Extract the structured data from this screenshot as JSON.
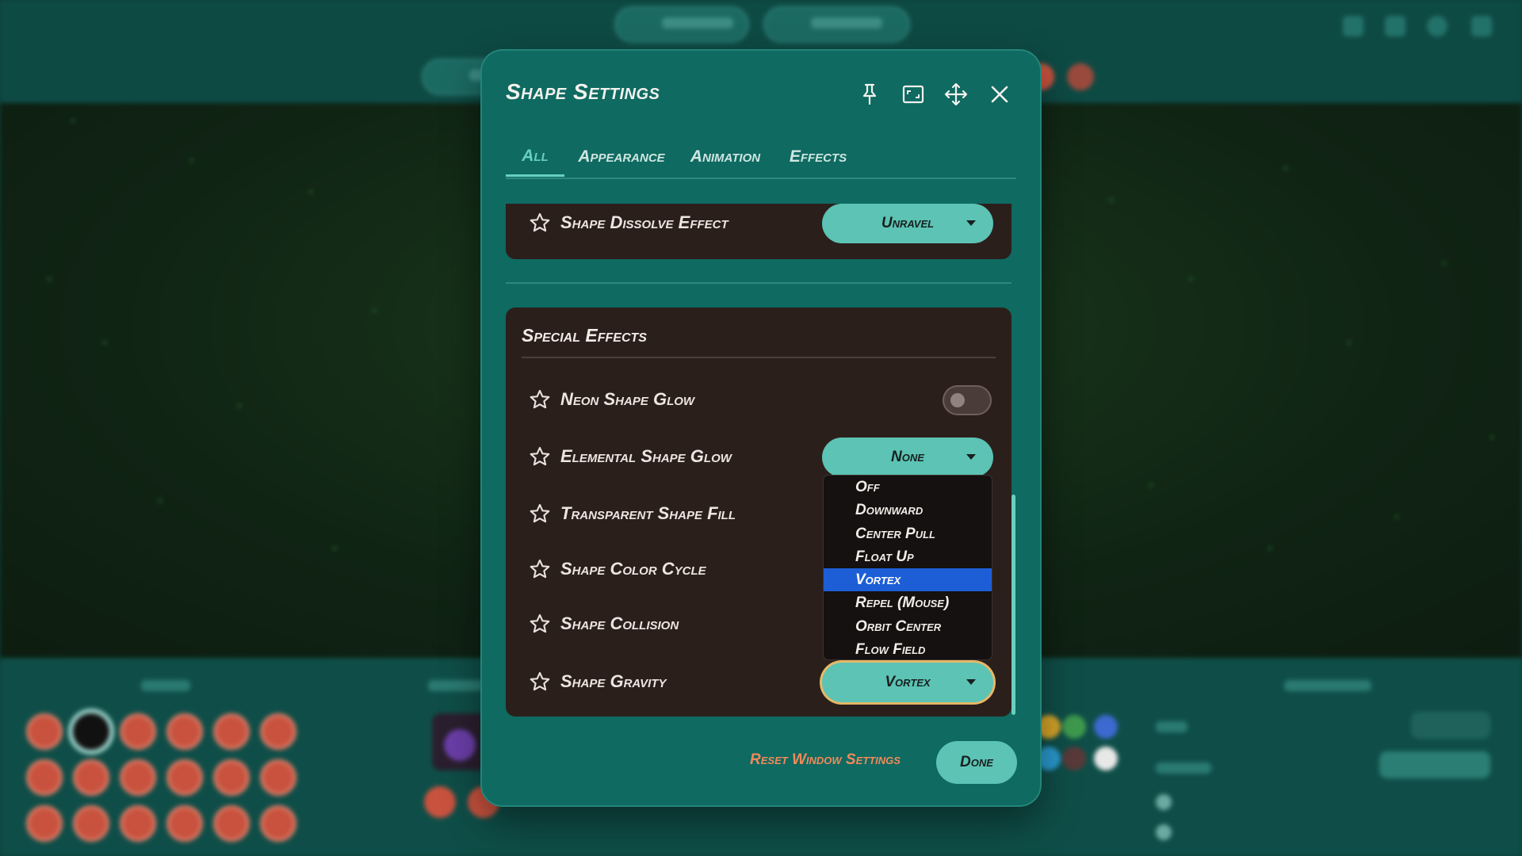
{
  "dialog": {
    "title": "Shape Settings",
    "header_icons": [
      "pin-icon",
      "aspect-ratio-icon",
      "move-icon",
      "close-icon"
    ]
  },
  "tabs": [
    {
      "label": "All",
      "active": true
    },
    {
      "label": "Appearance",
      "active": false
    },
    {
      "label": "Animation",
      "active": false
    },
    {
      "label": "Effects",
      "active": false
    }
  ],
  "top_section": {
    "dissolve": {
      "label": "Shape Dissolve Effect",
      "value": "Unravel"
    }
  },
  "special_effects": {
    "heading": "Special Effects",
    "rows": {
      "neon": {
        "label": "Neon Shape Glow",
        "toggle_on": false
      },
      "elemental": {
        "label": "Elemental Shape Glow",
        "value": "None"
      },
      "transparent": {
        "label": "Transparent Shape Fill"
      },
      "color_cycle": {
        "label": "Shape Color Cycle"
      },
      "collision": {
        "label": "Shape Collision"
      },
      "gravity": {
        "label": "Shape Gravity",
        "value": "Vortex"
      }
    }
  },
  "gravity_menu": {
    "options": [
      "Off",
      "Downward",
      "Center Pull",
      "Float Up",
      "Vortex",
      "Repel (Mouse)",
      "Orbit Center",
      "Flow Field"
    ],
    "highlighted": "Vortex"
  },
  "footer": {
    "reset_label": "Reset Window Settings",
    "done_label": "Done"
  },
  "colors": {
    "modal_bg": "#0f6a61",
    "accent": "#5cc3b5",
    "panel_bg": "#2b1f1c",
    "highlight": "#1d5ed6",
    "link": "#f08a5a"
  }
}
